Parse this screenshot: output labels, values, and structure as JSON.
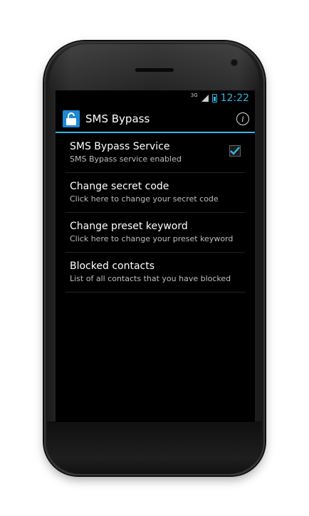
{
  "statusbar": {
    "network_type": "3G",
    "time": "12:22",
    "accent_color": "#33b5e5",
    "icons": [
      "signal-icon",
      "battery-icon"
    ]
  },
  "actionbar": {
    "app_icon": "lock-icon",
    "title": "SMS Bypass",
    "info_icon": "info-icon"
  },
  "preferences": [
    {
      "title": "SMS Bypass Service",
      "summary": "SMS Bypass service enabled",
      "checked": true
    },
    {
      "title": "Change secret code",
      "summary": "Click here to change your secret code"
    },
    {
      "title": "Change preset keyword",
      "summary": "Click here to change your preset keyword"
    },
    {
      "title": "Blocked contacts",
      "summary": "List of all contacts that you have blocked"
    }
  ]
}
